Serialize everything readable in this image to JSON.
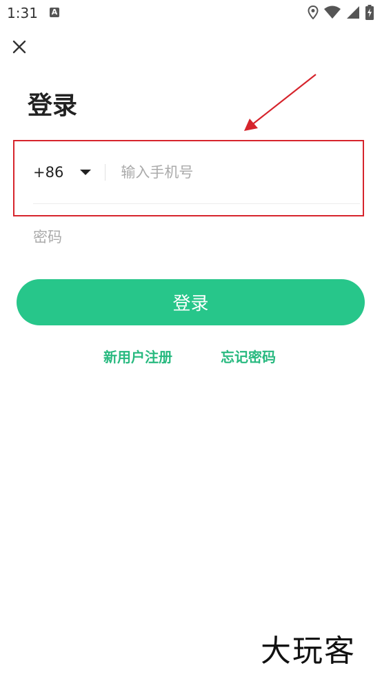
{
  "status_bar": {
    "time": "1:31",
    "notification_icon_letter": "A",
    "icons": [
      "location-icon",
      "wifi-icon",
      "signal-icon",
      "battery-charging-icon"
    ]
  },
  "header": {
    "close_icon": "close-icon",
    "title": "登录"
  },
  "form": {
    "country_code": "+86",
    "phone_placeholder": "输入手机号",
    "password_placeholder": "密码",
    "login_label": "登录"
  },
  "links": {
    "register": "新用户注册",
    "forgot_password": "忘记密码"
  },
  "annotation": {
    "color": "#d6242c"
  },
  "colors": {
    "accent": "#27c68a",
    "link": "#27b97f"
  },
  "watermark": "大玩客"
}
